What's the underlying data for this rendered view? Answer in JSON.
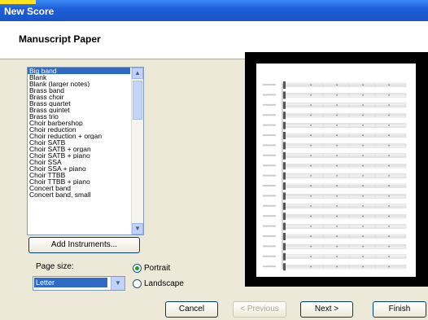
{
  "window": {
    "title": "New Score"
  },
  "header": {
    "title": "Manuscript Paper"
  },
  "list": {
    "items": [
      "Big band",
      "Blank",
      "Blank (larger notes)",
      "Brass band",
      "Brass choir",
      "Brass quartet",
      "Brass quintet",
      "Brass trio",
      "Choir barbershop",
      "Choir reduction",
      "Choir reduction + organ",
      "Choir SATB",
      "Choir SATB + organ",
      "Choir SATB + piano",
      "Choir SSA",
      "Choir SSA + piano",
      "Choir TTBB",
      "Choir TTBB + piano",
      "Concert band",
      "Concert band, small"
    ],
    "selected_index": 0
  },
  "buttons": {
    "add_instruments": "Add Instruments...",
    "cancel": "Cancel",
    "previous": "< Previous",
    "next": "Next >",
    "finish": "Finish"
  },
  "page_size": {
    "label": "Page size:",
    "value": "Letter"
  },
  "orientation": {
    "portrait": "Portrait",
    "landscape": "Landscape",
    "selected": "portrait"
  },
  "colors": {
    "titlebar": "#1e5fd8",
    "selection": "#316ac5",
    "accent_yellow": "#ffe21f"
  }
}
